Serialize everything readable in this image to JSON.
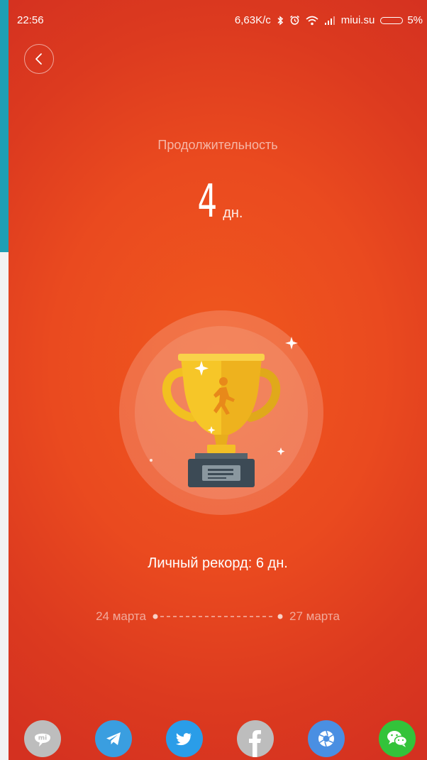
{
  "status_bar": {
    "time": "22:56",
    "speed": "6,63K/c",
    "carrier": "miui.su",
    "battery": "5%"
  },
  "header": {
    "back_icon": "chevron-left-icon"
  },
  "stats": {
    "label": "Продолжительность",
    "value": "4",
    "unit": "дн."
  },
  "trophy": {
    "icon": "trophy-runner-icon"
  },
  "record": {
    "text": "Личный рекорд: 6 дн."
  },
  "timeline": {
    "start": "24 марта",
    "end": "27 марта"
  },
  "share": [
    {
      "name": "mi-talk",
      "icon": "mi-chat-icon",
      "color": "#bdbdbd"
    },
    {
      "name": "telegram",
      "icon": "telegram-icon",
      "color": "#3a9ee0"
    },
    {
      "name": "twitter",
      "icon": "twitter-icon",
      "color": "#2a9de8"
    },
    {
      "name": "facebook",
      "icon": "facebook-icon",
      "color": "#bdbdbd"
    },
    {
      "name": "camera",
      "icon": "aperture-icon",
      "color": "#4a8fe2"
    },
    {
      "name": "wechat",
      "icon": "wechat-icon",
      "color": "#33c33a"
    }
  ],
  "colors": {
    "background": "#ea4a1f",
    "trophy_gold": "#f5c623",
    "plaque": "#3c4a55"
  }
}
